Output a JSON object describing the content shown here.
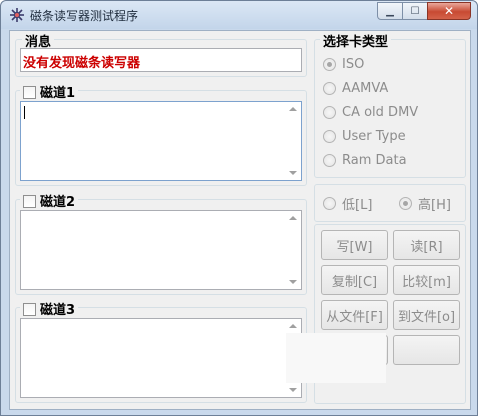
{
  "window": {
    "title": "磁条读写器测试程序",
    "icon": "gear-app-icon",
    "controls": {
      "minimize": "minimize-icon",
      "maximize": "maximize-icon",
      "close": "close-icon"
    }
  },
  "message": {
    "label": "消息",
    "value": "没有发现磁条读写器",
    "value_color": "#cc0000"
  },
  "tracks": [
    {
      "label": "磁道1",
      "checked": false,
      "value": ""
    },
    {
      "label": "磁道2",
      "checked": false,
      "value": ""
    },
    {
      "label": "磁道3",
      "checked": false,
      "value": ""
    }
  ],
  "card_type": {
    "label": "选择卡类型",
    "options": [
      "ISO",
      "AAMVA",
      "CA old DMV",
      "User Type",
      "Ram Data"
    ],
    "selected": "ISO"
  },
  "coercivity": {
    "options": [
      "低[L]",
      "高[H]"
    ],
    "selected": "高[H]"
  },
  "buttons": {
    "write": "写[W]",
    "read": "读[R]",
    "copy": "复制[C]",
    "compare": "比较[m]",
    "from_file": "从文件[F]",
    "to_file": "到文件[o]"
  }
}
